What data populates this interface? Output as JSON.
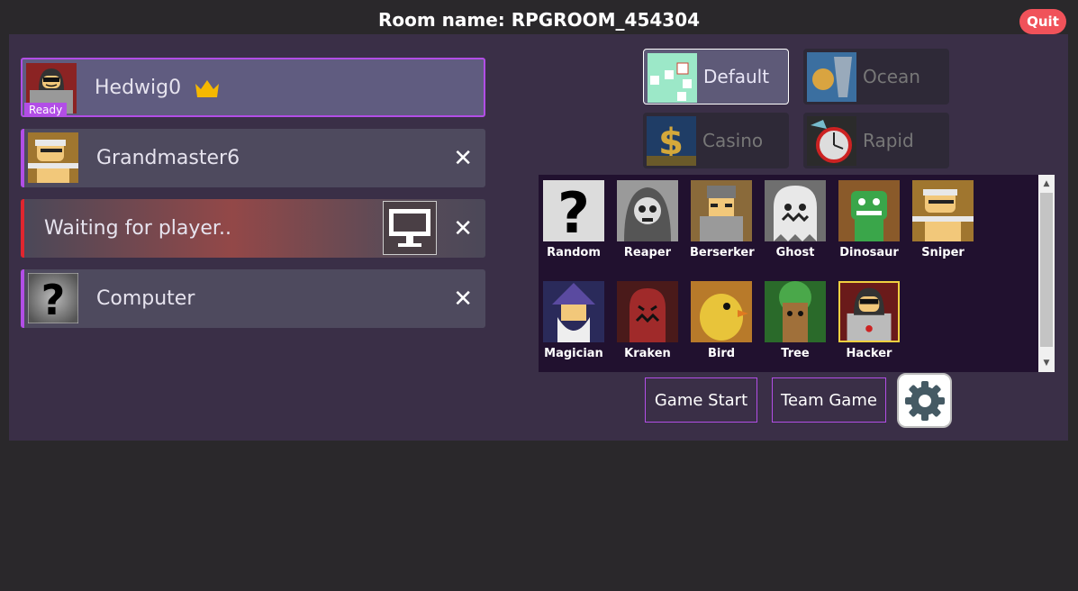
{
  "room": {
    "title": "Room name: RPGROOM_454304",
    "quit_label": "Quit"
  },
  "players": [
    {
      "name": "Hedwig0",
      "status": "Ready",
      "is_host": true
    },
    {
      "name": "Grandmaster6"
    },
    {
      "name": "Waiting for player.."
    },
    {
      "name": "Computer"
    }
  ],
  "maps": [
    {
      "label": "Default",
      "selected": true
    },
    {
      "label": "Ocean"
    },
    {
      "label": "Casino"
    },
    {
      "label": "Rapid"
    }
  ],
  "characters": [
    "Random",
    "Reaper",
    "Berserker",
    "Ghost",
    "Dinosaur",
    "Sniper",
    "Magician",
    "Kraken",
    "Bird",
    "Tree",
    "Hacker"
  ],
  "selected_character": "Hacker",
  "buttons": {
    "game_start": "Game Start",
    "team_game": "Team Game"
  },
  "icons": [
    "crown-icon",
    "close-icon",
    "monitor-icon",
    "question-mark-icon",
    "gear-icon"
  ],
  "colors": {
    "accent": "#b24ee6",
    "quit": "#f0525a",
    "waiting": "#e0262f",
    "crown": "#f5b800"
  }
}
